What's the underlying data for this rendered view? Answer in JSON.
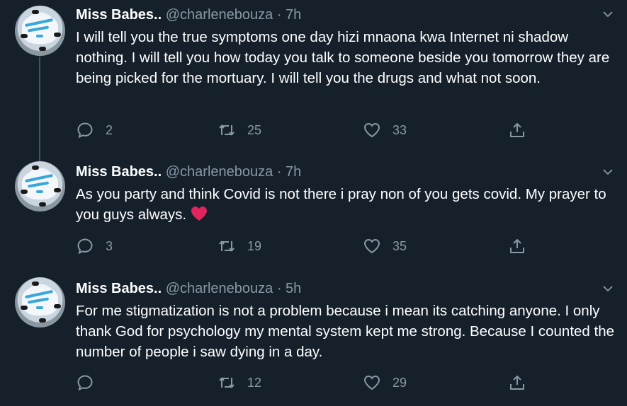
{
  "tweets": [
    {
      "name": "Miss Babes..",
      "handle": "@charlenebouza",
      "separator": "·",
      "time": "7h",
      "text": "I will tell you the true symptoms one day hizi mnaona kwa Internet ni shadow nothing. I will tell you how today you talk to someone beside you tomorrow they are being picked for the mortuary. I will tell you the drugs and what not soon.",
      "replies": "2",
      "retweets": "25",
      "likes": "33"
    },
    {
      "name": "Miss Babes..",
      "handle": "@charlenebouza",
      "separator": "·",
      "time": "7h",
      "text": "As you party and think Covid is not there i pray non of you gets covid. My prayer to you guys always.",
      "emoji": "red-heart",
      "replies": "3",
      "retweets": "19",
      "likes": "35"
    },
    {
      "name": "Miss Babes..",
      "handle": "@charlenebouza",
      "separator": "·",
      "time": "5h",
      "text": "For me stigmatization is not a problem because i mean its catching anyone. I only thank God for psychology my mental system kept me strong. Because I counted the number of people i saw dying in a day.",
      "replies": "",
      "retweets": "12",
      "likes": "29"
    }
  ],
  "colors": {
    "background": "#15202b",
    "text": "#ffffff",
    "muted": "#8899a6",
    "thread_line": "#3d5466",
    "heart": "#e0245e"
  }
}
